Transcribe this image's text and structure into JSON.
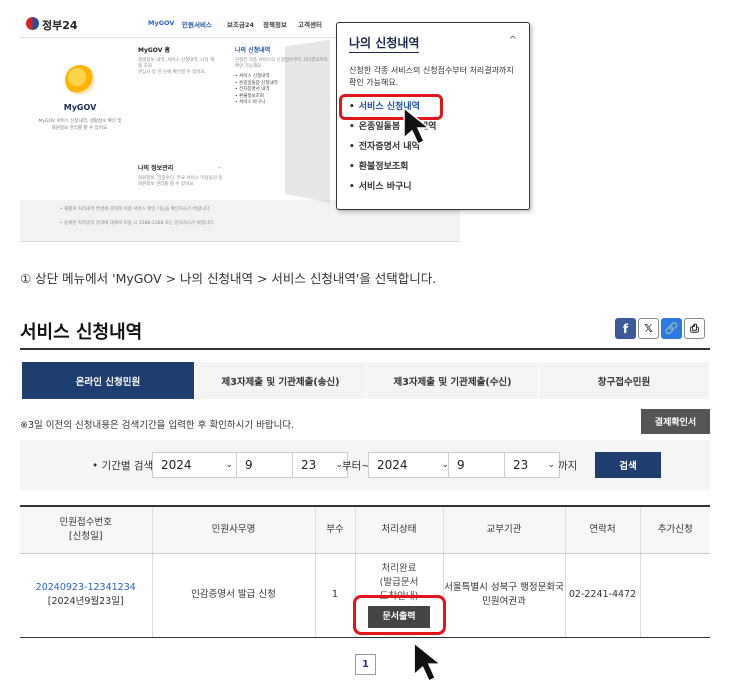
{
  "header": {
    "logo": "정부24",
    "gnb": [
      "MyGOV",
      "민원서비스",
      "보조금24",
      "정책정보",
      "고객센터"
    ]
  },
  "mega_menu": {
    "title": "MyGOV",
    "desc": [
      "MyGOV 서비스 신청내역, 생활정보 확인 및",
      "회원정보 관리를 할 수 있어요."
    ],
    "col1_title": "MyGOV 홈",
    "col1_sub": [
      "생생정보 내역, 서비스 신청내역, 나의 혜택 조회",
      "관심사 등 한 눈에 확인할 수 있어요."
    ],
    "col2_title": "나의 신청내역",
    "col2_sub": [
      "신청한 각종 서비스의 신청접수부터 처리결과까지",
      "확인 가능해요."
    ],
    "col2_items": [
      "• 서비스 신청내역",
      "• 온종일돌봄 신청내역",
      "• 전자증명서 내역",
      "• 환불정보조회",
      "• 서비스 바구니"
    ],
    "col3_title": "나의 정보관리",
    "col3_sub": [
      "회원정보, 인증수단, 주요 서비스 이용동의 등",
      "회원정보 관리를 할 수 있어요."
    ],
    "bottom_notes": [
      "• 재활서 처리내역 변경에 관하여 이용 서비스 확인 기능을 확인하시기 바랍니다.",
      "• 등록된 처리방식 결과에 대해서 이용 시 1588-2188 또는 문의하시기 바랍니다."
    ]
  },
  "popup": {
    "title": "나의 신청내역",
    "caret": "^",
    "desc": "신청한 각종 서비스의 신청접수부터 처리결과까지 확인 가능해요.",
    "items": [
      "서비스 신청내역",
      "온종일돌봄 신청내역",
      "전자증명서 내역",
      "환불정보조회",
      "서비스 바구니"
    ]
  },
  "caption": "① 상단 메뉴에서 'MyGOV > 나의 신청내역 > 서비스 신청내역'을 선택합니다.",
  "page": {
    "title": "서비스 신청내역",
    "tabs": [
      "온라인 신청민원",
      "제3자제출 및 기관제출(송신)",
      "제3자제출 및 기관제출(수신)",
      "창구접수민원"
    ],
    "notice": "※3일 이전의 신청내용은 검색기간을 입력한 후 확인하시기 바랍니다.",
    "receipt_button": "결제확인서",
    "search": {
      "label": "• 기간별 검색",
      "from_year": "2024",
      "from_month": "9",
      "from_day": "23",
      "from_word": "부터~",
      "to_year": "2024",
      "to_month": "9",
      "to_day": "23",
      "to_word": "까지",
      "button": "검색"
    },
    "table": {
      "headers": [
        "민원접수번호\n[신청일]",
        "민원사무명",
        "부수",
        "처리상태",
        "교부기관",
        "연락처",
        "추가신청"
      ],
      "row": {
        "num": "20240923-12341234",
        "date": "[2024년9월23일]",
        "name": "인감증명서 발급 신청",
        "count": "1",
        "status": "처리완료\n(발급문서\n도착안내)",
        "print_button": "문서출력",
        "office": "서울특별시 성북구 행정문화국 민원여권과",
        "phone": "02-2241-4472",
        "extra": ""
      }
    },
    "pager": "1"
  }
}
